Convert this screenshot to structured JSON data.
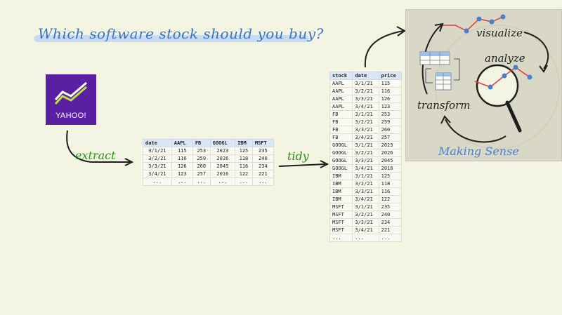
{
  "title": "Which software stock should you buy?",
  "logo": {
    "text": "YAHOO!",
    "bg_color": "#5b1fa3"
  },
  "labels": {
    "extract": "extract",
    "tidy": "tidy",
    "visualize": "visualize",
    "analyze": "analyze",
    "transform": "transform",
    "making_sense": "Making Sense"
  },
  "wide_table": {
    "columns": [
      "date",
      "AAPL",
      "FB",
      "GOOGL",
      "IBM",
      "MSFT"
    ],
    "rows": [
      [
        "3/1/21",
        "115",
        "253",
        "2023",
        "125",
        "235"
      ],
      [
        "3/2/21",
        "116",
        "259",
        "2026",
        "118",
        "240"
      ],
      [
        "3/3/21",
        "126",
        "260",
        "2045",
        "116",
        "234"
      ],
      [
        "3/4/21",
        "123",
        "257",
        "2016",
        "122",
        "221"
      ],
      [
        "...",
        "...",
        "...",
        "...",
        "...",
        "..."
      ]
    ]
  },
  "tidy_table": {
    "columns": [
      "stock",
      "date",
      "price"
    ],
    "rows": [
      [
        "AAPL",
        "3/1/21",
        "115"
      ],
      [
        "AAPL",
        "3/2/21",
        "116"
      ],
      [
        "AAPL",
        "3/3/21",
        "126"
      ],
      [
        "AAPL",
        "3/4/21",
        "123"
      ],
      [
        "FB",
        "3/1/21",
        "253"
      ],
      [
        "FB",
        "3/2/21",
        "259"
      ],
      [
        "FB",
        "3/3/21",
        "260"
      ],
      [
        "FB",
        "3/4/21",
        "257"
      ],
      [
        "GOOGL",
        "3/1/21",
        "2023"
      ],
      [
        "GOOGL",
        "3/2/21",
        "2026"
      ],
      [
        "GOOGL",
        "3/3/21",
        "2045"
      ],
      [
        "GOOGL",
        "3/4/21",
        "2016"
      ],
      [
        "IBM",
        "3/1/21",
        "125"
      ],
      [
        "IBM",
        "3/2/21",
        "118"
      ],
      [
        "IBM",
        "3/3/21",
        "116"
      ],
      [
        "IBM",
        "3/4/21",
        "122"
      ],
      [
        "MSFT",
        "3/1/21",
        "235"
      ],
      [
        "MSFT",
        "3/2/21",
        "240"
      ],
      [
        "MSFT",
        "3/3/21",
        "234"
      ],
      [
        "MSFT",
        "3/4/21",
        "221"
      ],
      [
        "...",
        "...",
        "..."
      ]
    ]
  },
  "colors": {
    "title_text": "#3a72c8",
    "highlight": "#c7dcf2",
    "label_green": "#2f8f1a",
    "label_blue": "#4a7fd0",
    "line_red": "#e03a3a",
    "point_blue": "#4a7fd0"
  }
}
